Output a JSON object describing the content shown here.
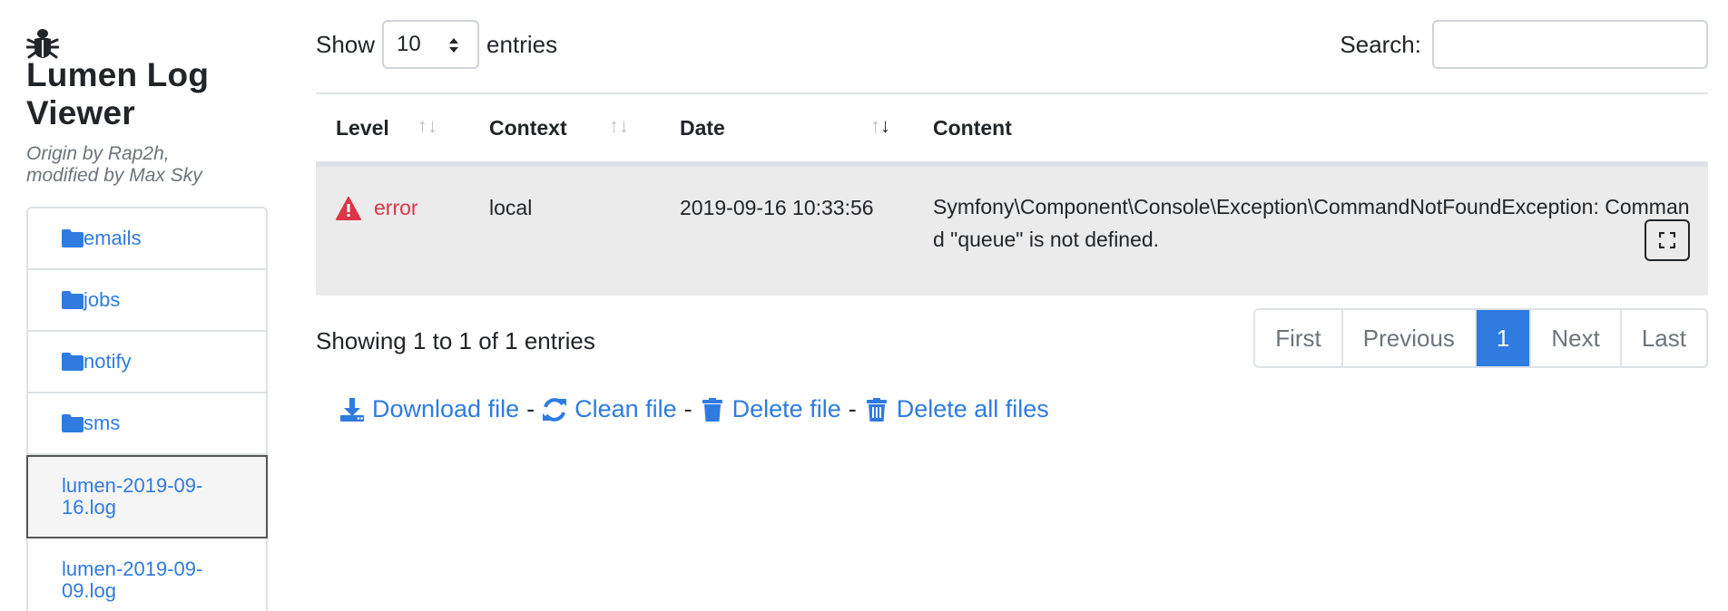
{
  "app": {
    "title": "Lumen Log Viewer",
    "subtitle_line1": "Origin by Rap2h,",
    "subtitle_line2": "modified by Max Sky"
  },
  "sidebar": {
    "folders": [
      {
        "label": "emails",
        "icon": "folder-icon"
      },
      {
        "label": "jobs",
        "icon": "folder-icon"
      },
      {
        "label": "notify",
        "icon": "folder-icon"
      },
      {
        "label": "sms",
        "icon": "folder-icon"
      }
    ],
    "files": [
      {
        "label": "lumen-2019-09-16.log",
        "active": true
      },
      {
        "label": "lumen-2019-09-09.log",
        "active": false
      }
    ]
  },
  "controls": {
    "show_label": "Show",
    "page_size": "10",
    "entries_label": "entries",
    "search_label": "Search:",
    "search_value": ""
  },
  "table": {
    "headers": {
      "level": "Level",
      "context": "Context",
      "date": "Date",
      "content": "Content"
    },
    "sort_glyph": "↑↓",
    "rows": [
      {
        "level": "error",
        "context": "local",
        "date": "2019-09-16 10:33:56",
        "content": "Symfony\\Component\\Console\\Exception\\CommandNotFoundException: Command \"queue\" is not defined."
      }
    ]
  },
  "pagination": {
    "info": "Showing 1 to 1 of 1 entries",
    "first": "First",
    "previous": "Previous",
    "current": "1",
    "next": "Next",
    "last": "Last"
  },
  "actions": {
    "download": "Download file",
    "clean": "Clean file",
    "delete": "Delete file",
    "delete_all": "Delete all files",
    "separator": "-"
  },
  "colors": {
    "link": "#2f7be0",
    "error": "#dc3545",
    "row_bg": "#ebebeb",
    "active_page": "#2f7be0"
  }
}
